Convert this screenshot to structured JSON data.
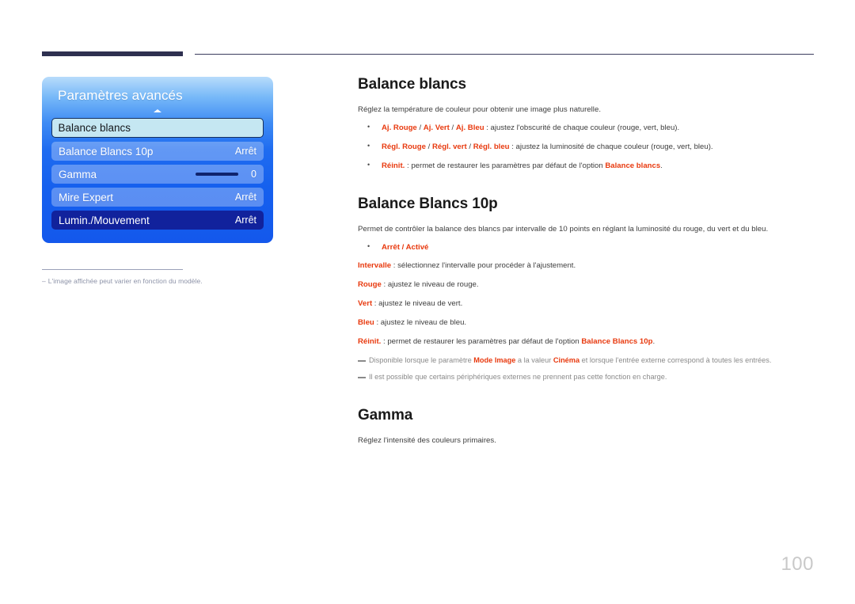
{
  "header": {
    "bar_color": "#2e3050",
    "line_color": "#3b3d5e"
  },
  "osd": {
    "title": "Paramètres avancés",
    "scroll_up_icon": "triangle-up-icon",
    "rows": [
      {
        "label": "Balance blancs",
        "value": "",
        "state": "highlight"
      },
      {
        "label": "Balance Blancs 10p",
        "value": "Arrêt",
        "state": "normal"
      },
      {
        "label": "Gamma",
        "value": "0",
        "state": "normal",
        "slider": true
      },
      {
        "label": "Mire Expert",
        "value": "Arrêt",
        "state": "normal"
      },
      {
        "label": "Lumin./Mouvement",
        "value": "Arrêt",
        "state": "selected"
      }
    ]
  },
  "caption": {
    "dash": "–",
    "text": "L'image affichée peut varier en fonction du modèle."
  },
  "sections": {
    "balance_blancs": {
      "heading": "Balance blancs",
      "intro": "Réglez la température de couleur pour obtenir une image plus naturelle.",
      "bullets": [
        {
          "kw1": "Aj. Rouge",
          "s1": " / ",
          "kw2": "Aj. Vert",
          "s2": " / ",
          "kw3": "Aj. Bleu",
          "rest": " : ajustez l'obscurité de chaque couleur (rouge, vert, bleu)."
        },
        {
          "kw1": "Régl. Rouge",
          "s1": " / ",
          "kw2": "Régl. vert",
          "s2": " / ",
          "kw3": "Régl. bleu",
          "rest": " : ajustez la luminosité de chaque couleur (rouge, vert, bleu)."
        },
        {
          "kw1": "Réinit.",
          "rest_a": " : permet de restaurer les paramètres par défaut de l'option ",
          "kw_tail": "Balance blancs",
          "rest_b": "."
        }
      ]
    },
    "balance_blancs_10p": {
      "heading": "Balance Blancs 10p",
      "intro": "Permet de contrôler la balance des blancs par intervalle de 10 points en réglant la luminosité du rouge, du vert et du bleu.",
      "bullet_onoff": {
        "kw1": "Arrêt",
        "sep": " / ",
        "kw2": "Activé"
      },
      "terms": [
        {
          "kw": "Intervalle",
          "rest": " : sélectionnez l'intervalle pour procéder à l'ajustement."
        },
        {
          "kw": "Rouge",
          "rest": " : ajustez le niveau de rouge."
        },
        {
          "kw": "Vert",
          "rest": " : ajustez le niveau de vert."
        },
        {
          "kw": "Bleu",
          "rest": " : ajustez le niveau de bleu."
        }
      ],
      "reinit": {
        "kw": "Réinit.",
        "rest_a": " : permet de restaurer les paramètres par défaut de l'option ",
        "kw_tail": "Balance Blancs 10p",
        "rest_b": "."
      },
      "notes": [
        {
          "a": "Disponible lorsque le paramètre ",
          "kw1": "Mode Image",
          "b": " a la valeur ",
          "kw2": "Cinéma",
          "c": " et lorsque l'entrée externe correspond à toutes les entrées."
        },
        {
          "a": "Il est possible que certains périphériques externes ne prennent pas cette fonction en charge."
        }
      ]
    },
    "gamma": {
      "heading": "Gamma",
      "intro": "Réglez l'intensité des couleurs primaires."
    }
  },
  "page_number": "100",
  "colors": {
    "keyword_red": "#e8390e",
    "osd_blue": "#1560ee",
    "osd_selected": "#11229c",
    "osd_highlight": "#c5e7f2",
    "page_number_gray": "#c9c9c9"
  }
}
